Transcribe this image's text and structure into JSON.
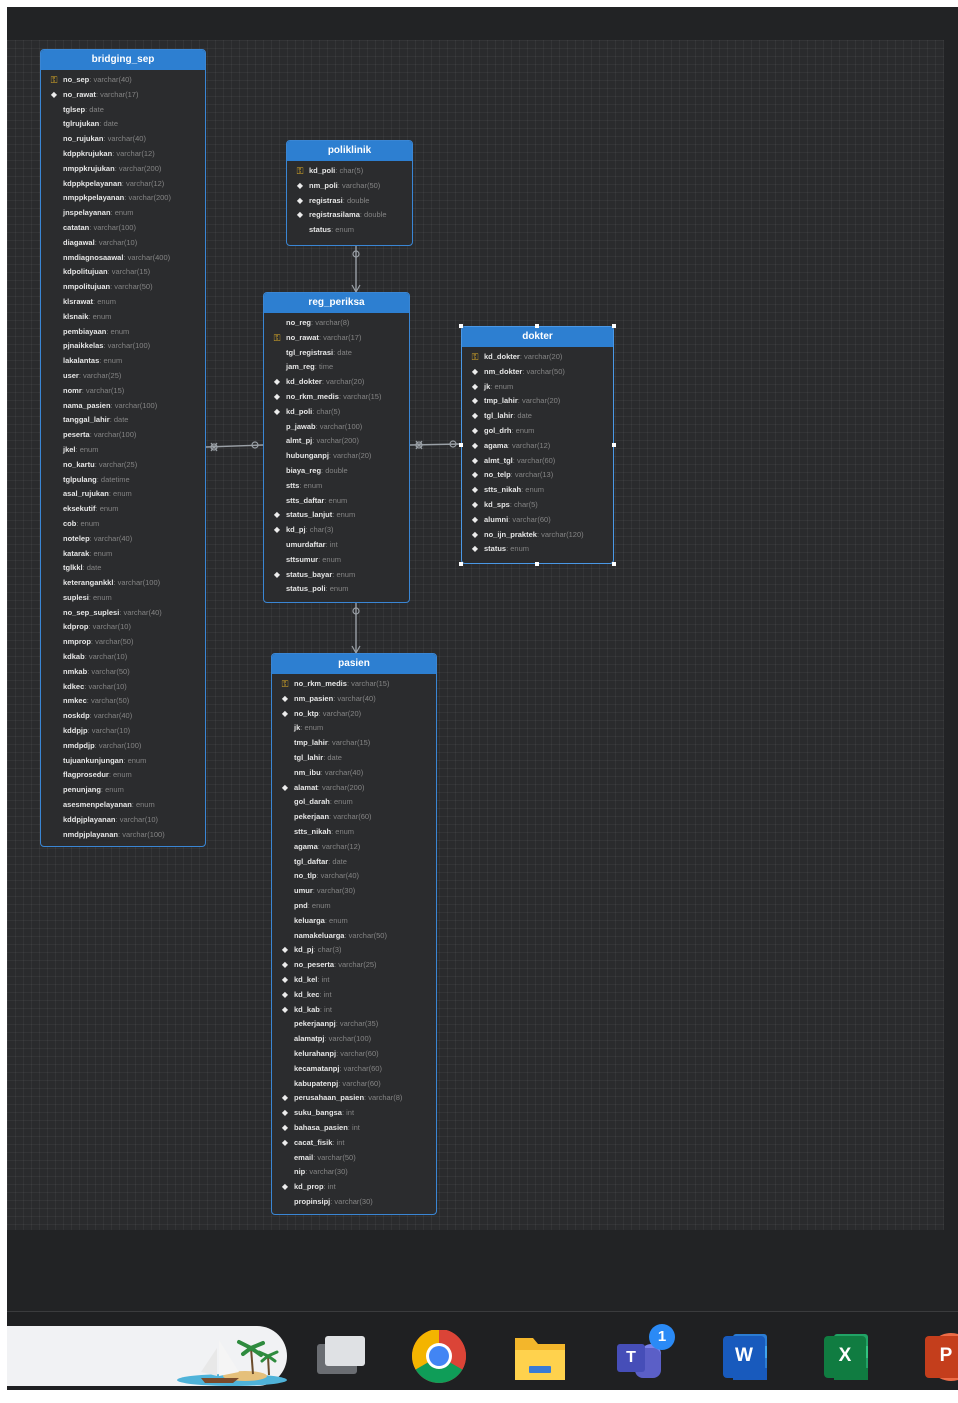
{
  "tables": {
    "bridging_sep": {
      "title": "bridging_sep",
      "columns": [
        {
          "name": "no_sep",
          "type": "varchar(40)",
          "key": "pk"
        },
        {
          "name": "no_rawat",
          "type": "varchar(17)",
          "key": "fk"
        },
        {
          "name": "tglsep",
          "type": "date",
          "key": ""
        },
        {
          "name": "tglrujukan",
          "type": "date",
          "key": ""
        },
        {
          "name": "no_rujukan",
          "type": "varchar(40)",
          "key": ""
        },
        {
          "name": "kdppkrujukan",
          "type": "varchar(12)",
          "key": ""
        },
        {
          "name": "nmppkrujukan",
          "type": "varchar(200)",
          "key": ""
        },
        {
          "name": "kdppkpelayanan",
          "type": "varchar(12)",
          "key": ""
        },
        {
          "name": "nmppkpelayanan",
          "type": "varchar(200)",
          "key": ""
        },
        {
          "name": "jnspelayanan",
          "type": "enum",
          "key": ""
        },
        {
          "name": "catatan",
          "type": "varchar(100)",
          "key": ""
        },
        {
          "name": "diagawal",
          "type": "varchar(10)",
          "key": ""
        },
        {
          "name": "nmdiagnosaawal",
          "type": "varchar(400)",
          "key": ""
        },
        {
          "name": "kdpolitujuan",
          "type": "varchar(15)",
          "key": ""
        },
        {
          "name": "nmpolitujuan",
          "type": "varchar(50)",
          "key": ""
        },
        {
          "name": "klsrawat",
          "type": "enum",
          "key": ""
        },
        {
          "name": "klsnaik",
          "type": "enum",
          "key": ""
        },
        {
          "name": "pembiayaan",
          "type": "enum",
          "key": ""
        },
        {
          "name": "pjnaikkelas",
          "type": "varchar(100)",
          "key": ""
        },
        {
          "name": "lakalantas",
          "type": "enum",
          "key": ""
        },
        {
          "name": "user",
          "type": "varchar(25)",
          "key": ""
        },
        {
          "name": "nomr",
          "type": "varchar(15)",
          "key": ""
        },
        {
          "name": "nama_pasien",
          "type": "varchar(100)",
          "key": ""
        },
        {
          "name": "tanggal_lahir",
          "type": "date",
          "key": ""
        },
        {
          "name": "peserta",
          "type": "varchar(100)",
          "key": ""
        },
        {
          "name": "jkel",
          "type": "enum",
          "key": ""
        },
        {
          "name": "no_kartu",
          "type": "varchar(25)",
          "key": ""
        },
        {
          "name": "tglpulang",
          "type": "datetime",
          "key": ""
        },
        {
          "name": "asal_rujukan",
          "type": "enum",
          "key": ""
        },
        {
          "name": "eksekutif",
          "type": "enum",
          "key": ""
        },
        {
          "name": "cob",
          "type": "enum",
          "key": ""
        },
        {
          "name": "notelep",
          "type": "varchar(40)",
          "key": ""
        },
        {
          "name": "katarak",
          "type": "enum",
          "key": ""
        },
        {
          "name": "tglkkl",
          "type": "date",
          "key": ""
        },
        {
          "name": "keterangankkl",
          "type": "varchar(100)",
          "key": ""
        },
        {
          "name": "suplesi",
          "type": "enum",
          "key": ""
        },
        {
          "name": "no_sep_suplesi",
          "type": "varchar(40)",
          "key": ""
        },
        {
          "name": "kdprop",
          "type": "varchar(10)",
          "key": ""
        },
        {
          "name": "nmprop",
          "type": "varchar(50)",
          "key": ""
        },
        {
          "name": "kdkab",
          "type": "varchar(10)",
          "key": ""
        },
        {
          "name": "nmkab",
          "type": "varchar(50)",
          "key": ""
        },
        {
          "name": "kdkec",
          "type": "varchar(10)",
          "key": ""
        },
        {
          "name": "nmkec",
          "type": "varchar(50)",
          "key": ""
        },
        {
          "name": "noskdp",
          "type": "varchar(40)",
          "key": ""
        },
        {
          "name": "kddpjp",
          "type": "varchar(10)",
          "key": ""
        },
        {
          "name": "nmdpdjp",
          "type": "varchar(100)",
          "key": ""
        },
        {
          "name": "tujuankunjungan",
          "type": "enum",
          "key": ""
        },
        {
          "name": "flagprosedur",
          "type": "enum",
          "key": ""
        },
        {
          "name": "penunjang",
          "type": "enum",
          "key": ""
        },
        {
          "name": "asesmenpelayanan",
          "type": "enum",
          "key": ""
        },
        {
          "name": "kddpjplayanan",
          "type": "varchar(10)",
          "key": ""
        },
        {
          "name": "nmdpjplayanan",
          "type": "varchar(100)",
          "key": ""
        }
      ]
    },
    "poliklinik": {
      "title": "poliklinik",
      "columns": [
        {
          "name": "kd_poli",
          "type": "char(5)",
          "key": "pk"
        },
        {
          "name": "nm_poli",
          "type": "varchar(50)",
          "key": "fk"
        },
        {
          "name": "registrasi",
          "type": "double",
          "key": "fk"
        },
        {
          "name": "registrasilama",
          "type": "double",
          "key": "fk"
        },
        {
          "name": "status",
          "type": "enum",
          "key": ""
        }
      ]
    },
    "reg_periksa": {
      "title": "reg_periksa",
      "columns": [
        {
          "name": "no_reg",
          "type": "varchar(8)",
          "key": ""
        },
        {
          "name": "no_rawat",
          "type": "varchar(17)",
          "key": "pk"
        },
        {
          "name": "tgl_registrasi",
          "type": "date",
          "key": ""
        },
        {
          "name": "jam_reg",
          "type": "time",
          "key": ""
        },
        {
          "name": "kd_dokter",
          "type": "varchar(20)",
          "key": "fk"
        },
        {
          "name": "no_rkm_medis",
          "type": "varchar(15)",
          "key": "fk"
        },
        {
          "name": "kd_poli",
          "type": "char(5)",
          "key": "fk"
        },
        {
          "name": "p_jawab",
          "type": "varchar(100)",
          "key": ""
        },
        {
          "name": "almt_pj",
          "type": "varchar(200)",
          "key": ""
        },
        {
          "name": "hubunganpj",
          "type": "varchar(20)",
          "key": ""
        },
        {
          "name": "biaya_reg",
          "type": "double",
          "key": ""
        },
        {
          "name": "stts",
          "type": "enum",
          "key": ""
        },
        {
          "name": "stts_daftar",
          "type": "enum",
          "key": ""
        },
        {
          "name": "status_lanjut",
          "type": "enum",
          "key": "fk"
        },
        {
          "name": "kd_pj",
          "type": "char(3)",
          "key": "fk"
        },
        {
          "name": "umurdaftar",
          "type": "int",
          "key": ""
        },
        {
          "name": "sttsumur",
          "type": "enum",
          "key": ""
        },
        {
          "name": "status_bayar",
          "type": "enum",
          "key": "fk"
        },
        {
          "name": "status_poli",
          "type": "enum",
          "key": ""
        }
      ]
    },
    "dokter": {
      "title": "dokter",
      "columns": [
        {
          "name": "kd_dokter",
          "type": "varchar(20)",
          "key": "pk"
        },
        {
          "name": "nm_dokter",
          "type": "varchar(50)",
          "key": "fk"
        },
        {
          "name": "jk",
          "type": "enum",
          "key": "fk"
        },
        {
          "name": "tmp_lahir",
          "type": "varchar(20)",
          "key": "fk"
        },
        {
          "name": "tgl_lahir",
          "type": "date",
          "key": "fk"
        },
        {
          "name": "gol_drh",
          "type": "enum",
          "key": "fk"
        },
        {
          "name": "agama",
          "type": "varchar(12)",
          "key": "fk"
        },
        {
          "name": "almt_tgl",
          "type": "varchar(60)",
          "key": "fk"
        },
        {
          "name": "no_telp",
          "type": "varchar(13)",
          "key": "fk"
        },
        {
          "name": "stts_nikah",
          "type": "enum",
          "key": "fk"
        },
        {
          "name": "kd_sps",
          "type": "char(5)",
          "key": "fk"
        },
        {
          "name": "alumni",
          "type": "varchar(60)",
          "key": "fk"
        },
        {
          "name": "no_ijn_praktek",
          "type": "varchar(120)",
          "key": "fk"
        },
        {
          "name": "status",
          "type": "enum",
          "key": "fk"
        }
      ]
    },
    "pasien": {
      "title": "pasien",
      "columns": [
        {
          "name": "no_rkm_medis",
          "type": "varchar(15)",
          "key": "pk"
        },
        {
          "name": "nm_pasien",
          "type": "varchar(40)",
          "key": "fk"
        },
        {
          "name": "no_ktp",
          "type": "varchar(20)",
          "key": "fk"
        },
        {
          "name": "jk",
          "type": "enum",
          "key": ""
        },
        {
          "name": "tmp_lahir",
          "type": "varchar(15)",
          "key": ""
        },
        {
          "name": "tgl_lahir",
          "type": "date",
          "key": ""
        },
        {
          "name": "nm_ibu",
          "type": "varchar(40)",
          "key": ""
        },
        {
          "name": "alamat",
          "type": "varchar(200)",
          "key": "fk"
        },
        {
          "name": "gol_darah",
          "type": "enum",
          "key": ""
        },
        {
          "name": "pekerjaan",
          "type": "varchar(60)",
          "key": ""
        },
        {
          "name": "stts_nikah",
          "type": "enum",
          "key": ""
        },
        {
          "name": "agama",
          "type": "varchar(12)",
          "key": ""
        },
        {
          "name": "tgl_daftar",
          "type": "date",
          "key": ""
        },
        {
          "name": "no_tlp",
          "type": "varchar(40)",
          "key": ""
        },
        {
          "name": "umur",
          "type": "varchar(30)",
          "key": ""
        },
        {
          "name": "pnd",
          "type": "enum",
          "key": ""
        },
        {
          "name": "keluarga",
          "type": "enum",
          "key": ""
        },
        {
          "name": "namakeluarga",
          "type": "varchar(50)",
          "key": ""
        },
        {
          "name": "kd_pj",
          "type": "char(3)",
          "key": "fk"
        },
        {
          "name": "no_peserta",
          "type": "varchar(25)",
          "key": "fk"
        },
        {
          "name": "kd_kel",
          "type": "int",
          "key": "fk"
        },
        {
          "name": "kd_kec",
          "type": "int",
          "key": "fk"
        },
        {
          "name": "kd_kab",
          "type": "int",
          "key": "fk"
        },
        {
          "name": "pekerjaanpj",
          "type": "varchar(35)",
          "key": ""
        },
        {
          "name": "alamatpj",
          "type": "varchar(100)",
          "key": ""
        },
        {
          "name": "kelurahanpj",
          "type": "varchar(60)",
          "key": ""
        },
        {
          "name": "kecamatanpj",
          "type": "varchar(60)",
          "key": ""
        },
        {
          "name": "kabupatenpj",
          "type": "varchar(60)",
          "key": ""
        },
        {
          "name": "perusahaan_pasien",
          "type": "varchar(8)",
          "key": "fk"
        },
        {
          "name": "suku_bangsa",
          "type": "int",
          "key": "fk"
        },
        {
          "name": "bahasa_pasien",
          "type": "int",
          "key": "fk"
        },
        {
          "name": "cacat_fisik",
          "type": "int",
          "key": "fk"
        },
        {
          "name": "email",
          "type": "varchar(50)",
          "key": ""
        },
        {
          "name": "nip",
          "type": "varchar(30)",
          "key": ""
        },
        {
          "name": "kd_prop",
          "type": "int",
          "key": "fk"
        },
        {
          "name": "propinsipj",
          "type": "varchar(30)",
          "key": ""
        }
      ]
    }
  },
  "taskbar": {
    "items": [
      {
        "name": "desktop-preview-pill",
        "icon": "sailboat-island-thumbnail"
      },
      {
        "name": "task-view",
        "icon": "task-view-icon"
      },
      {
        "name": "chrome",
        "icon": "chrome-icon"
      },
      {
        "name": "file-explorer",
        "icon": "folder-icon"
      },
      {
        "name": "teams",
        "icon": "teams-icon",
        "letter": "T",
        "badge": "1"
      },
      {
        "name": "word",
        "icon": "word-icon",
        "letter": "W"
      },
      {
        "name": "excel",
        "icon": "excel-icon",
        "letter": "X"
      },
      {
        "name": "powerpoint",
        "icon": "powerpoint-icon",
        "letter": "P"
      }
    ]
  },
  "colors": {
    "canvas": "#2a2b2d",
    "table_header": "#2d7fd1",
    "table_border": "#3a86d4",
    "primary_key": "#e3b027"
  }
}
